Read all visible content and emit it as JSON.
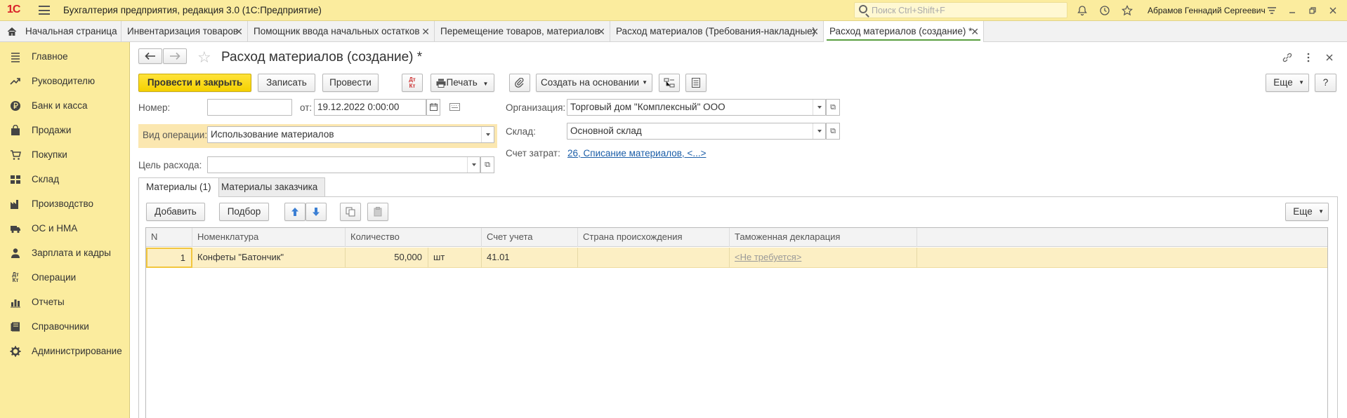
{
  "header": {
    "logo": "1С",
    "app_title": "Бухгалтерия предприятия, редакция 3.0  (1С:Предприятие)",
    "search_placeholder": "Поиск Ctrl+Shift+F",
    "user_name": "Абрамов Геннадий Сергеевич"
  },
  "tabs": [
    {
      "label": "Начальная страница",
      "closable": false
    },
    {
      "label": "Инвентаризация товаров",
      "closable": true
    },
    {
      "label": "Помощник ввода начальных остатков",
      "closable": true
    },
    {
      "label": "Перемещение товаров, материалов",
      "closable": true
    },
    {
      "label": "Расход материалов (Требования-накладные)",
      "closable": true
    },
    {
      "label": "Расход материалов (создание) *",
      "closable": true,
      "active": true
    }
  ],
  "sidebar": {
    "items": [
      {
        "label": "Главное",
        "icon": "menu-lines-icon"
      },
      {
        "label": "Руководителю",
        "icon": "trend-up-icon"
      },
      {
        "label": "Банк и касса",
        "icon": "ruble-coin-icon"
      },
      {
        "label": "Продажи",
        "icon": "bag-icon"
      },
      {
        "label": "Покупки",
        "icon": "cart-icon"
      },
      {
        "label": "Склад",
        "icon": "grid-icon"
      },
      {
        "label": "Производство",
        "icon": "factory-icon"
      },
      {
        "label": "ОС и НМА",
        "icon": "truck-icon"
      },
      {
        "label": "Зарплата и кадры",
        "icon": "person-icon"
      },
      {
        "label": "Операции",
        "icon": "dt-kt-icon"
      },
      {
        "label": "Отчеты",
        "icon": "bar-chart-icon"
      },
      {
        "label": "Справочники",
        "icon": "book-icon"
      },
      {
        "label": "Администрирование",
        "icon": "gear-icon"
      }
    ]
  },
  "form": {
    "title": "Расход материалов (создание) *",
    "toolbar": {
      "post_close": "Провести и закрыть",
      "save": "Записать",
      "post": "Провести",
      "dtkt": "Дт Кт",
      "print": "Печать",
      "create_based": "Создать на основании",
      "more": "Еще",
      "help": "?"
    },
    "fields": {
      "number_label": "Номер:",
      "number_value": "",
      "date_label": "от:",
      "date_value": "19.12.2022  0:00:00",
      "operation_label": "Вид операции:",
      "operation_value": "Использование материалов",
      "purpose_label": "Цель расхода:",
      "purpose_value": "",
      "org_label": "Организация:",
      "org_value": "Торговый дом \"Комплексный\" ООО",
      "warehouse_label": "Склад:",
      "warehouse_value": "Основной склад",
      "cost_account_label": "Счет затрат:",
      "cost_account_value": "26, Списание материалов, <...>"
    },
    "subtabs": [
      {
        "label": "Материалы (1)",
        "active": true
      },
      {
        "label": "Материалы заказчика",
        "active": false
      }
    ],
    "table_toolbar": {
      "add": "Добавить",
      "pick": "Подбор",
      "more": "Еще"
    },
    "table": {
      "columns": [
        "N",
        "Номенклатура",
        "Количество",
        "Счет учета",
        "Страна происхождения",
        "Таможенная декларация"
      ],
      "rows": [
        {
          "n": "1",
          "item": "Конфеты \"Батончик\"",
          "qty": "50,000",
          "unit": "шт",
          "account": "41.01",
          "country": "",
          "customs": "<Не требуется>"
        }
      ]
    }
  }
}
